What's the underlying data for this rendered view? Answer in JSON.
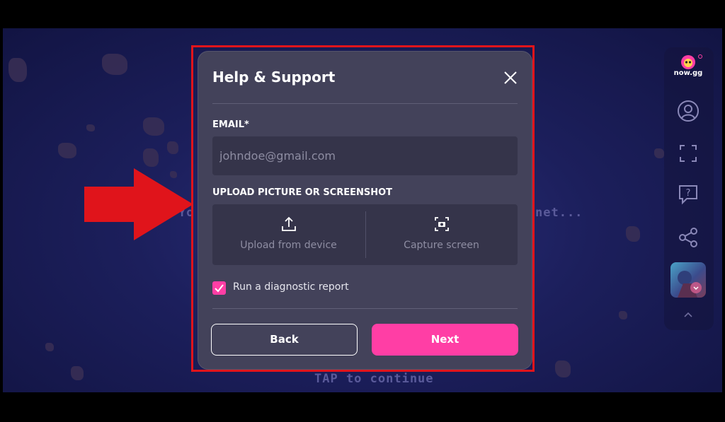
{
  "background": {
    "text_left": "Yo",
    "text_right": "net...",
    "text_bottom": "TAP to continue"
  },
  "sidebar": {
    "logo_text": "now.gg",
    "icons": [
      "user-icon",
      "fullscreen-icon",
      "help-icon",
      "share-icon",
      "game-thumbnail",
      "chevron-up-icon"
    ]
  },
  "modal": {
    "title": "Help & Support",
    "email": {
      "label": "EMAIL*",
      "placeholder": "johndoe@gmail.com",
      "value": ""
    },
    "upload": {
      "label": "UPLOAD PICTURE OR SCREENSHOT",
      "upload_device_label": "Upload from device",
      "capture_screen_label": "Capture screen"
    },
    "diagnostic": {
      "label": "Run a diagnostic report",
      "checked": true
    },
    "buttons": {
      "back_label": "Back",
      "next_label": "Next"
    }
  },
  "colors": {
    "accent": "#ff3ea5",
    "modal_bg": "#43425a",
    "input_bg": "#35344a",
    "annotation_red": "#e0141b"
  }
}
